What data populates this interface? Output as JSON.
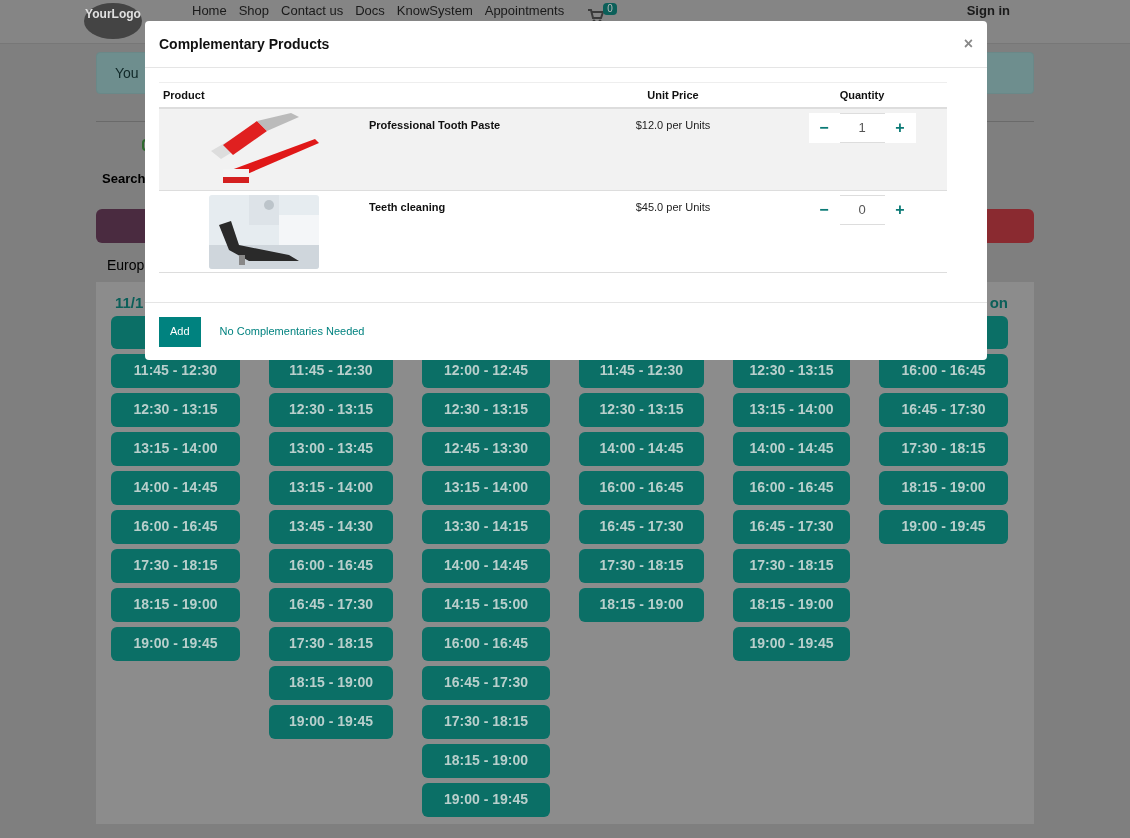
{
  "navbar": {
    "logo": "YourLogo",
    "links": [
      "Home",
      "Shop",
      "Contact us",
      "Docs",
      "KnowSystem",
      "Appointments"
    ],
    "cart_count": "0",
    "sign_in": "Sign in"
  },
  "alert": {
    "text": "You"
  },
  "search_label": "Search",
  "timezone": "Europ",
  "columns": [
    {
      "header": "11/1",
      "slots": [
        "11:45 - 12:30",
        "12:30 - 13:15",
        "13:15 - 14:00",
        "14:00 - 14:45",
        "16:00 - 16:45",
        "17:30 - 18:15",
        "18:15 - 19:00",
        "19:00 - 19:45"
      ]
    },
    {
      "slots": [
        "11:45 - 12:30",
        "12:30 - 13:15",
        "13:00 - 13:45",
        "13:15 - 14:00",
        "13:45 - 14:30",
        "16:00 - 16:45",
        "16:45 - 17:30",
        "17:30 - 18:15",
        "18:15 - 19:00",
        "19:00 - 19:45"
      ]
    },
    {
      "slots": [
        "12:00 - 12:45",
        "12:30 - 13:15",
        "12:45 - 13:30",
        "13:15 - 14:00",
        "13:30 - 14:15",
        "14:00 - 14:45",
        "14:15 - 15:00",
        "16:00 - 16:45",
        "16:45 - 17:30",
        "17:30 - 18:15",
        "18:15 - 19:00",
        "19:00 - 19:45"
      ]
    },
    {
      "slots": [
        "11:45 - 12:30",
        "12:30 - 13:15",
        "14:00 - 14:45",
        "16:00 - 16:45",
        "16:45 - 17:30",
        "17:30 - 18:15",
        "18:15 - 19:00"
      ]
    },
    {
      "slots": [
        "12:30 - 13:15",
        "13:15 - 14:00",
        "14:00 - 14:45",
        "16:00 - 16:45",
        "16:45 - 17:30",
        "17:30 - 18:15",
        "18:15 - 19:00",
        "19:00 - 19:45"
      ]
    },
    {
      "header": "on",
      "slots": [
        "16:00 - 16:45",
        "16:45 - 17:30",
        "17:30 - 18:15",
        "18:15 - 19:00",
        "19:00 - 19:45"
      ]
    }
  ],
  "modal": {
    "title": "Complementary Products",
    "close": "×",
    "table": {
      "columns": [
        "Product",
        "Unit Price",
        "Quantity"
      ],
      "rows": [
        {
          "name": "Professional Tooth Paste",
          "price": "$12.0 per Units",
          "quantity": "1",
          "selected": true
        },
        {
          "name": "Teeth cleaning",
          "price": "$45.0 per Units",
          "quantity": "0",
          "selected": false
        }
      ]
    },
    "minus": "−",
    "plus": "+",
    "buttons": {
      "add": "Add",
      "skip": "No Complementaries Needed"
    }
  }
}
